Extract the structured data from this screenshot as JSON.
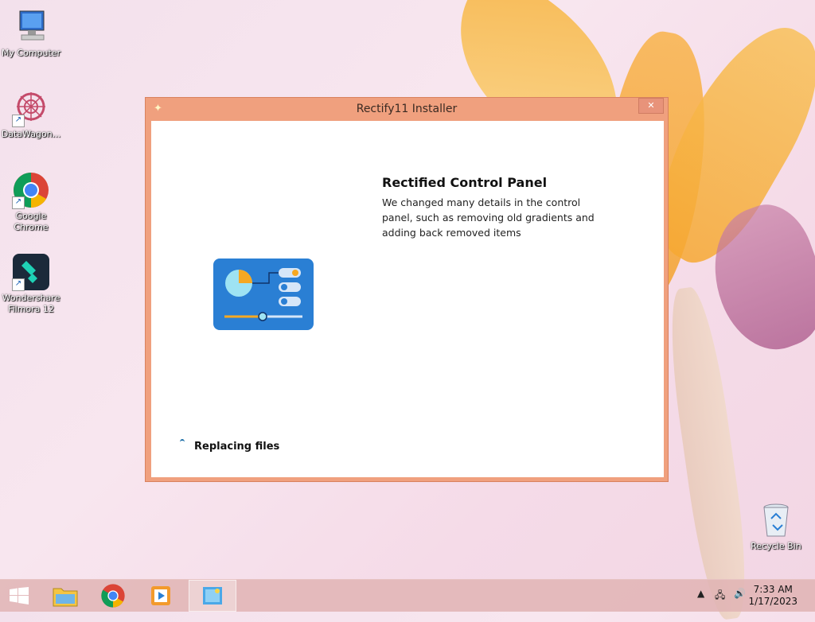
{
  "desktop": {
    "icons": [
      {
        "label": "My Computer"
      },
      {
        "label": "DataWagon..."
      },
      {
        "label": "Google Chrome"
      },
      {
        "label": "Wondershare Filmora 12"
      },
      {
        "label": "Recycle Bin"
      }
    ]
  },
  "window": {
    "title": "Rectify11 Installer",
    "close_label": "✕",
    "heading": "Rectified Control Panel",
    "description": "We changed many details in the control panel, such as removing old gradients and adding back removed items",
    "status": "Replacing files"
  },
  "taskbar": {
    "items": [
      "start",
      "file-explorer",
      "google-chrome",
      "media-player",
      "rectify11-installer"
    ],
    "clock": {
      "time": "7:33 AM",
      "date": "1/17/2023"
    }
  },
  "colors": {
    "window_frame": "#f0a07e",
    "accent_blue": "#2a7fd4",
    "taskbar": "#e1b4b4"
  }
}
